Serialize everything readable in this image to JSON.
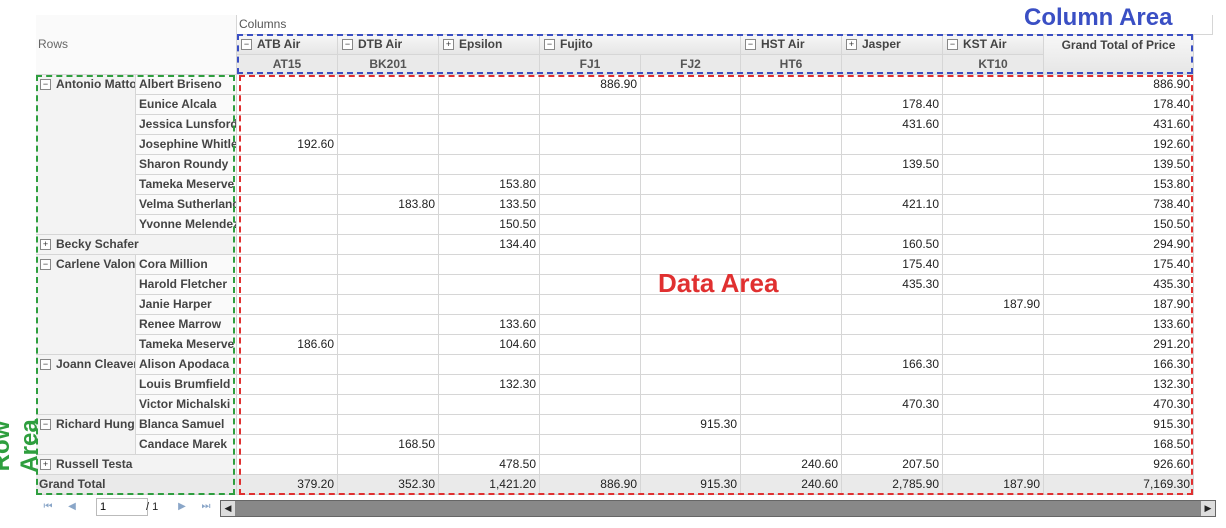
{
  "columns_title": "Columns",
  "rows_title": "Rows",
  "col_headers": [
    {
      "label": "ATB Air",
      "toggle": "−"
    },
    {
      "label": "DTB Air",
      "toggle": "−"
    },
    {
      "label": "Epsilon",
      "toggle": "+"
    },
    {
      "label": "Fujito",
      "toggle": "−"
    },
    {
      "label": "HST Air",
      "toggle": "−"
    },
    {
      "label": "Jasper",
      "toggle": "+"
    },
    {
      "label": "KST Air",
      "toggle": "−"
    }
  ],
  "grand_total_header": "Grand Total of Price",
  "sub_headers": [
    "AT15",
    "BK201",
    "",
    "FJ1",
    "FJ2",
    "HT6",
    "",
    "KT10",
    ""
  ],
  "row_groups": [
    {
      "name": "Antonio Mattos",
      "toggle": "−",
      "start": 0,
      "span": 8
    },
    {
      "name": "Becky Schafer",
      "toggle": "+",
      "start": 8,
      "span": 1
    },
    {
      "name": "Carlene Valon",
      "toggle": "−",
      "start": 9,
      "span": 5
    },
    {
      "name": "Joann Cleaver",
      "toggle": "−",
      "start": 14,
      "span": 3
    },
    {
      "name": "Richard Hung",
      "toggle": "−",
      "start": 17,
      "span": 2
    },
    {
      "name": "Russell Testa",
      "toggle": "+",
      "start": 19,
      "span": 1
    }
  ],
  "rows": [
    {
      "sub": "Albert Briseno",
      "v": [
        "",
        "",
        "",
        "886.90",
        "",
        "",
        "",
        "",
        "886.90"
      ]
    },
    {
      "sub": "Eunice Alcala",
      "v": [
        "",
        "",
        "",
        "",
        "",
        "",
        "178.40",
        "",
        "178.40"
      ]
    },
    {
      "sub": "Jessica Lunsford",
      "v": [
        "",
        "",
        "",
        "",
        "",
        "",
        "431.60",
        "",
        "431.60"
      ]
    },
    {
      "sub": "Josephine Whitley",
      "v": [
        "192.60",
        "",
        "",
        "",
        "",
        "",
        "",
        "",
        "192.60"
      ]
    },
    {
      "sub": "Sharon Roundy",
      "v": [
        "",
        "",
        "",
        "",
        "",
        "",
        "139.50",
        "",
        "139.50"
      ]
    },
    {
      "sub": "Tameka Meserve",
      "v": [
        "",
        "",
        "153.80",
        "",
        "",
        "",
        "",
        "",
        "153.80"
      ]
    },
    {
      "sub": "Velma Sutherland",
      "v": [
        "",
        "183.80",
        "133.50",
        "",
        "",
        "",
        "421.10",
        "",
        "738.40"
      ]
    },
    {
      "sub": "Yvonne Melendez",
      "v": [
        "",
        "",
        "150.50",
        "",
        "",
        "",
        "",
        "",
        "150.50"
      ]
    },
    {
      "sub": "",
      "v": [
        "",
        "",
        "134.40",
        "",
        "",
        "",
        "160.50",
        "",
        "294.90"
      ]
    },
    {
      "sub": "Cora Million",
      "v": [
        "",
        "",
        "",
        "",
        "",
        "",
        "175.40",
        "",
        "175.40"
      ]
    },
    {
      "sub": "Harold Fletcher",
      "v": [
        "",
        "",
        "",
        "",
        "",
        "",
        "435.30",
        "",
        "435.30"
      ]
    },
    {
      "sub": "Janie Harper",
      "v": [
        "",
        "",
        "",
        "",
        "",
        "",
        "",
        "187.90",
        "187.90"
      ]
    },
    {
      "sub": "Renee Marrow",
      "v": [
        "",
        "",
        "133.60",
        "",
        "",
        "",
        "",
        "",
        "133.60"
      ]
    },
    {
      "sub": "Tameka Meserve",
      "v": [
        "186.60",
        "",
        "104.60",
        "",
        "",
        "",
        "",
        "",
        "291.20"
      ]
    },
    {
      "sub": "Alison Apodaca",
      "v": [
        "",
        "",
        "",
        "",
        "",
        "",
        "166.30",
        "",
        "166.30"
      ]
    },
    {
      "sub": "Louis Brumfield",
      "v": [
        "",
        "",
        "132.30",
        "",
        "",
        "",
        "",
        "",
        "132.30"
      ]
    },
    {
      "sub": "Victor Michalski",
      "v": [
        "",
        "",
        "",
        "",
        "",
        "",
        "470.30",
        "",
        "470.30"
      ]
    },
    {
      "sub": "Blanca Samuel",
      "v": [
        "",
        "",
        "",
        "",
        "915.30",
        "",
        "",
        "",
        "915.30"
      ]
    },
    {
      "sub": "Candace Marek",
      "v": [
        "",
        "168.50",
        "",
        "",
        "",
        "",
        "",
        "",
        "168.50"
      ]
    },
    {
      "sub": "",
      "v": [
        "",
        "",
        "478.50",
        "",
        "",
        "240.60",
        "207.50",
        "",
        "926.60"
      ]
    }
  ],
  "grand_total": {
    "label": "Grand Total",
    "v": [
      "379.20",
      "352.30",
      "1,421.20",
      "886.90",
      "915.30",
      "240.60",
      "2,785.90",
      "187.90",
      "7,169.30"
    ]
  },
  "pager": {
    "page": "1",
    "of": "/ 1"
  },
  "overlays": {
    "column_area": "Column Area",
    "data_area": "Data Area",
    "row_area": "Row Area",
    "colors": {
      "column": "#3a4fc4",
      "data": "#e03030",
      "row": "#2e9e3e"
    }
  }
}
